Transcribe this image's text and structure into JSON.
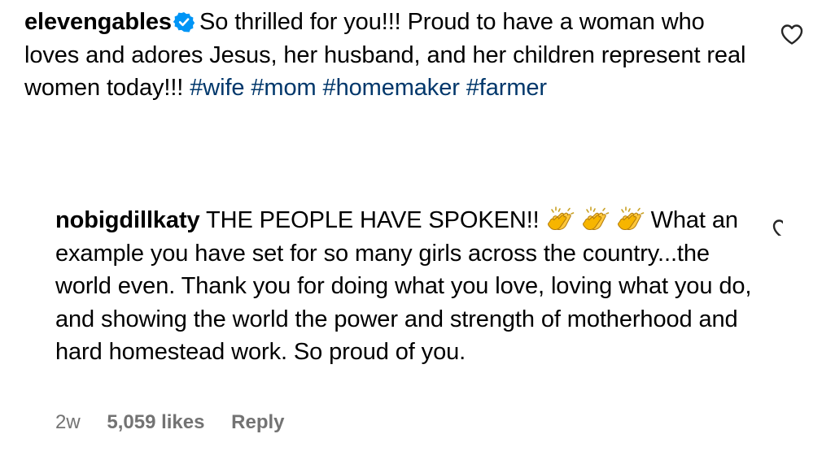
{
  "comments": [
    {
      "username": "elevengables",
      "verified": true,
      "text": "So thrilled for you!!! Proud to have a woman who loves and adores Jesus, her husband, and her children represent real women today!!!",
      "hashtags": [
        "#wife",
        "#mom",
        "#homemaker",
        "#farmer"
      ],
      "icons": {
        "verified": "verified-badge-icon",
        "like": "heart-icon"
      },
      "colors": {
        "verified": "#0095f6",
        "hashtag": "#00376b"
      }
    },
    {
      "username": "nobigdillkaty",
      "text_before": "THE PEOPLE HAVE SPOKEN!!",
      "emoji": [
        "👏",
        "👏",
        "👏"
      ],
      "text_after": "What an example you have set for so many girls across the country...the world even. Thank you for doing what you love, loving what you do, and showing the world the power and strength of motherhood and hard homestead work. So proud of you.",
      "meta": {
        "time": "2w",
        "likes": "5,059 likes",
        "reply": "Reply"
      },
      "icons": {
        "emoji": "clapping-hands-icon",
        "like": "heart-icon"
      },
      "colors": {
        "meta": "#737373"
      }
    }
  ]
}
